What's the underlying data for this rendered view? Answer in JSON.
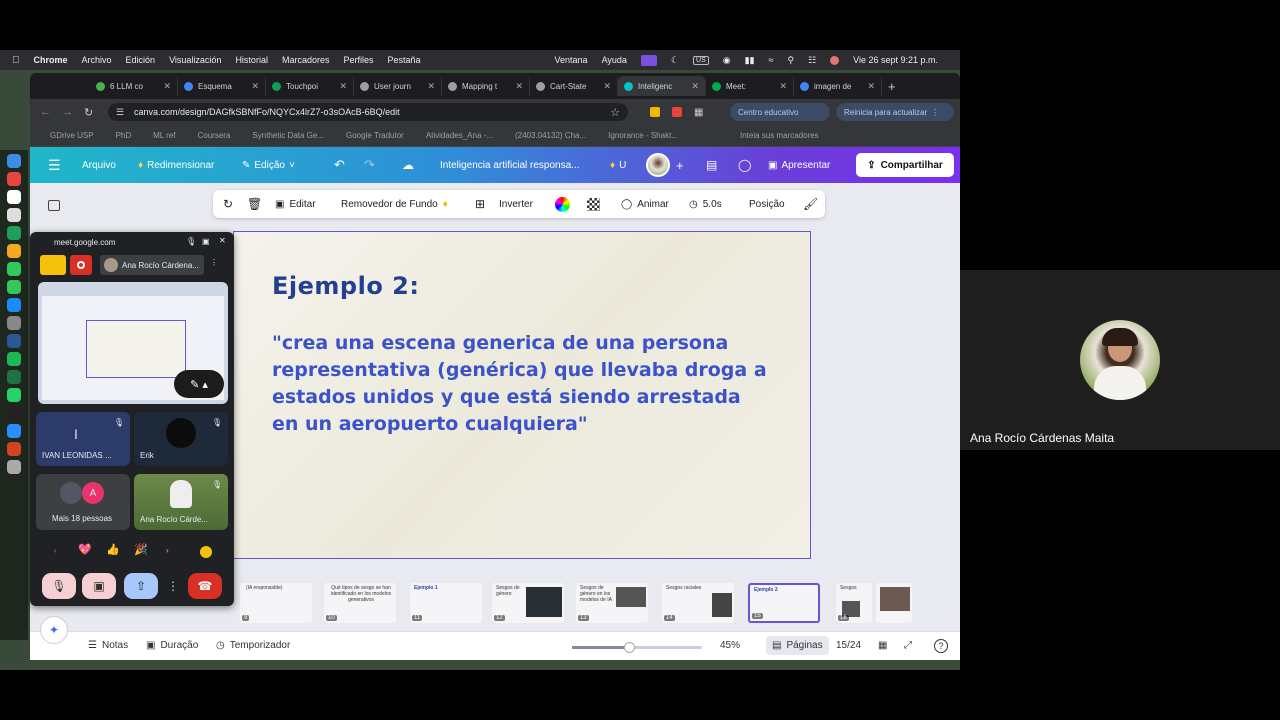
{
  "menubar": {
    "app": "Chrome",
    "items": [
      "Archivo",
      "Edición",
      "Visualización",
      "Historial",
      "Marcadores",
      "Perfiles",
      "Pestaña",
      "Ventana",
      "Ayuda"
    ],
    "keyboard": "US",
    "clock": "Vie 26 sept 9:21 p.m."
  },
  "tabs": [
    {
      "label": "6 LLM co",
      "color": "#4caf50"
    },
    {
      "label": "Esquema",
      "color": "#4285f4"
    },
    {
      "label": "Touchpoi",
      "color": "#0f9d58"
    },
    {
      "label": "User journ",
      "color": "#9aa0a6"
    },
    {
      "label": "Mapping t",
      "color": "#9aa0a6"
    },
    {
      "label": "Cart-State",
      "color": "#9aa0a6"
    },
    {
      "label": "Inteligenc",
      "color": "#00c4cc"
    },
    {
      "label": "Meet:",
      "color": "#00ac47"
    },
    {
      "label": "imagen de",
      "color": "#4285f4"
    }
  ],
  "address": {
    "url": "canva.com/design/DAGfkSBNfFo/NQYCx4lrZ7-o3sOAcB-6BQ/edit",
    "chip_education": "Centro educativo",
    "chip_update": "Reinicia para actualizar"
  },
  "bookmarks": [
    "GDrive USP",
    "PhD",
    "ML ref",
    "Coursera",
    "Synthetic Data Ge...",
    "Google Tradutor",
    "Atividades_Ana -...",
    "(2403.04132) Cha...",
    "Ignorance - Shakt...",
    "Inteia sus marcadores"
  ],
  "canva_top": {
    "file": "Arquivo",
    "resize": "Redimensionar",
    "edit": "Edição",
    "doc_title": "Inteligencia artificial responsa...",
    "user_initial": "U",
    "present": "Apresentar",
    "share": "Compartilhar"
  },
  "toolbar": {
    "edit": "Editar",
    "bg_remover": "Removedor de Fundo",
    "flip": "Inverter",
    "animate": "Animar",
    "duration": "5.0s",
    "position": "Posição"
  },
  "slide": {
    "title": "Ejemplo 2:",
    "body": "\"crea una escena generica de una persona representativa (genérica) que llevaba droga a estados unidos y que está siendo arrestada en un aeropuerto cualquiera\""
  },
  "thumbnails": [
    {
      "num": "9",
      "caption": "(IA responsable)"
    },
    {
      "num": "10",
      "caption": "Qué tipos de sesgo se han identificado en los modelos generativos"
    },
    {
      "num": "11",
      "caption": "Ejemplo 1"
    },
    {
      "num": "12",
      "caption": "Sesgos de género"
    },
    {
      "num": "13",
      "caption": "Sesgos de género en los modelos de IA"
    },
    {
      "num": "14",
      "caption": "Sesgos raciales"
    },
    {
      "num": "15",
      "caption": "Ejemplo 2"
    },
    {
      "num": "16",
      "caption": "Sesgos"
    }
  ],
  "bottombar": {
    "notes": "Notas",
    "duration": "Duração",
    "timer": "Temporizador",
    "zoom": "45%",
    "pages_label": "Páginas",
    "page_counter": "15/24"
  },
  "meet": {
    "domain": "meet.google.com",
    "presenter": "Ana Rocío Cárdena...",
    "participants": [
      {
        "name": "IVAN LEONIDAS ...",
        "initial": "I"
      },
      {
        "name": "Erik",
        "initial": ""
      },
      {
        "name": "Mais 18 pessoas",
        "initial": "A"
      },
      {
        "name": "Ana Rocío Cárde...",
        "initial": ""
      }
    ],
    "reactions": [
      "💖",
      "👍",
      "🎉"
    ]
  },
  "right_panel": {
    "name": "Ana Rocío Cárdenas Maita"
  }
}
